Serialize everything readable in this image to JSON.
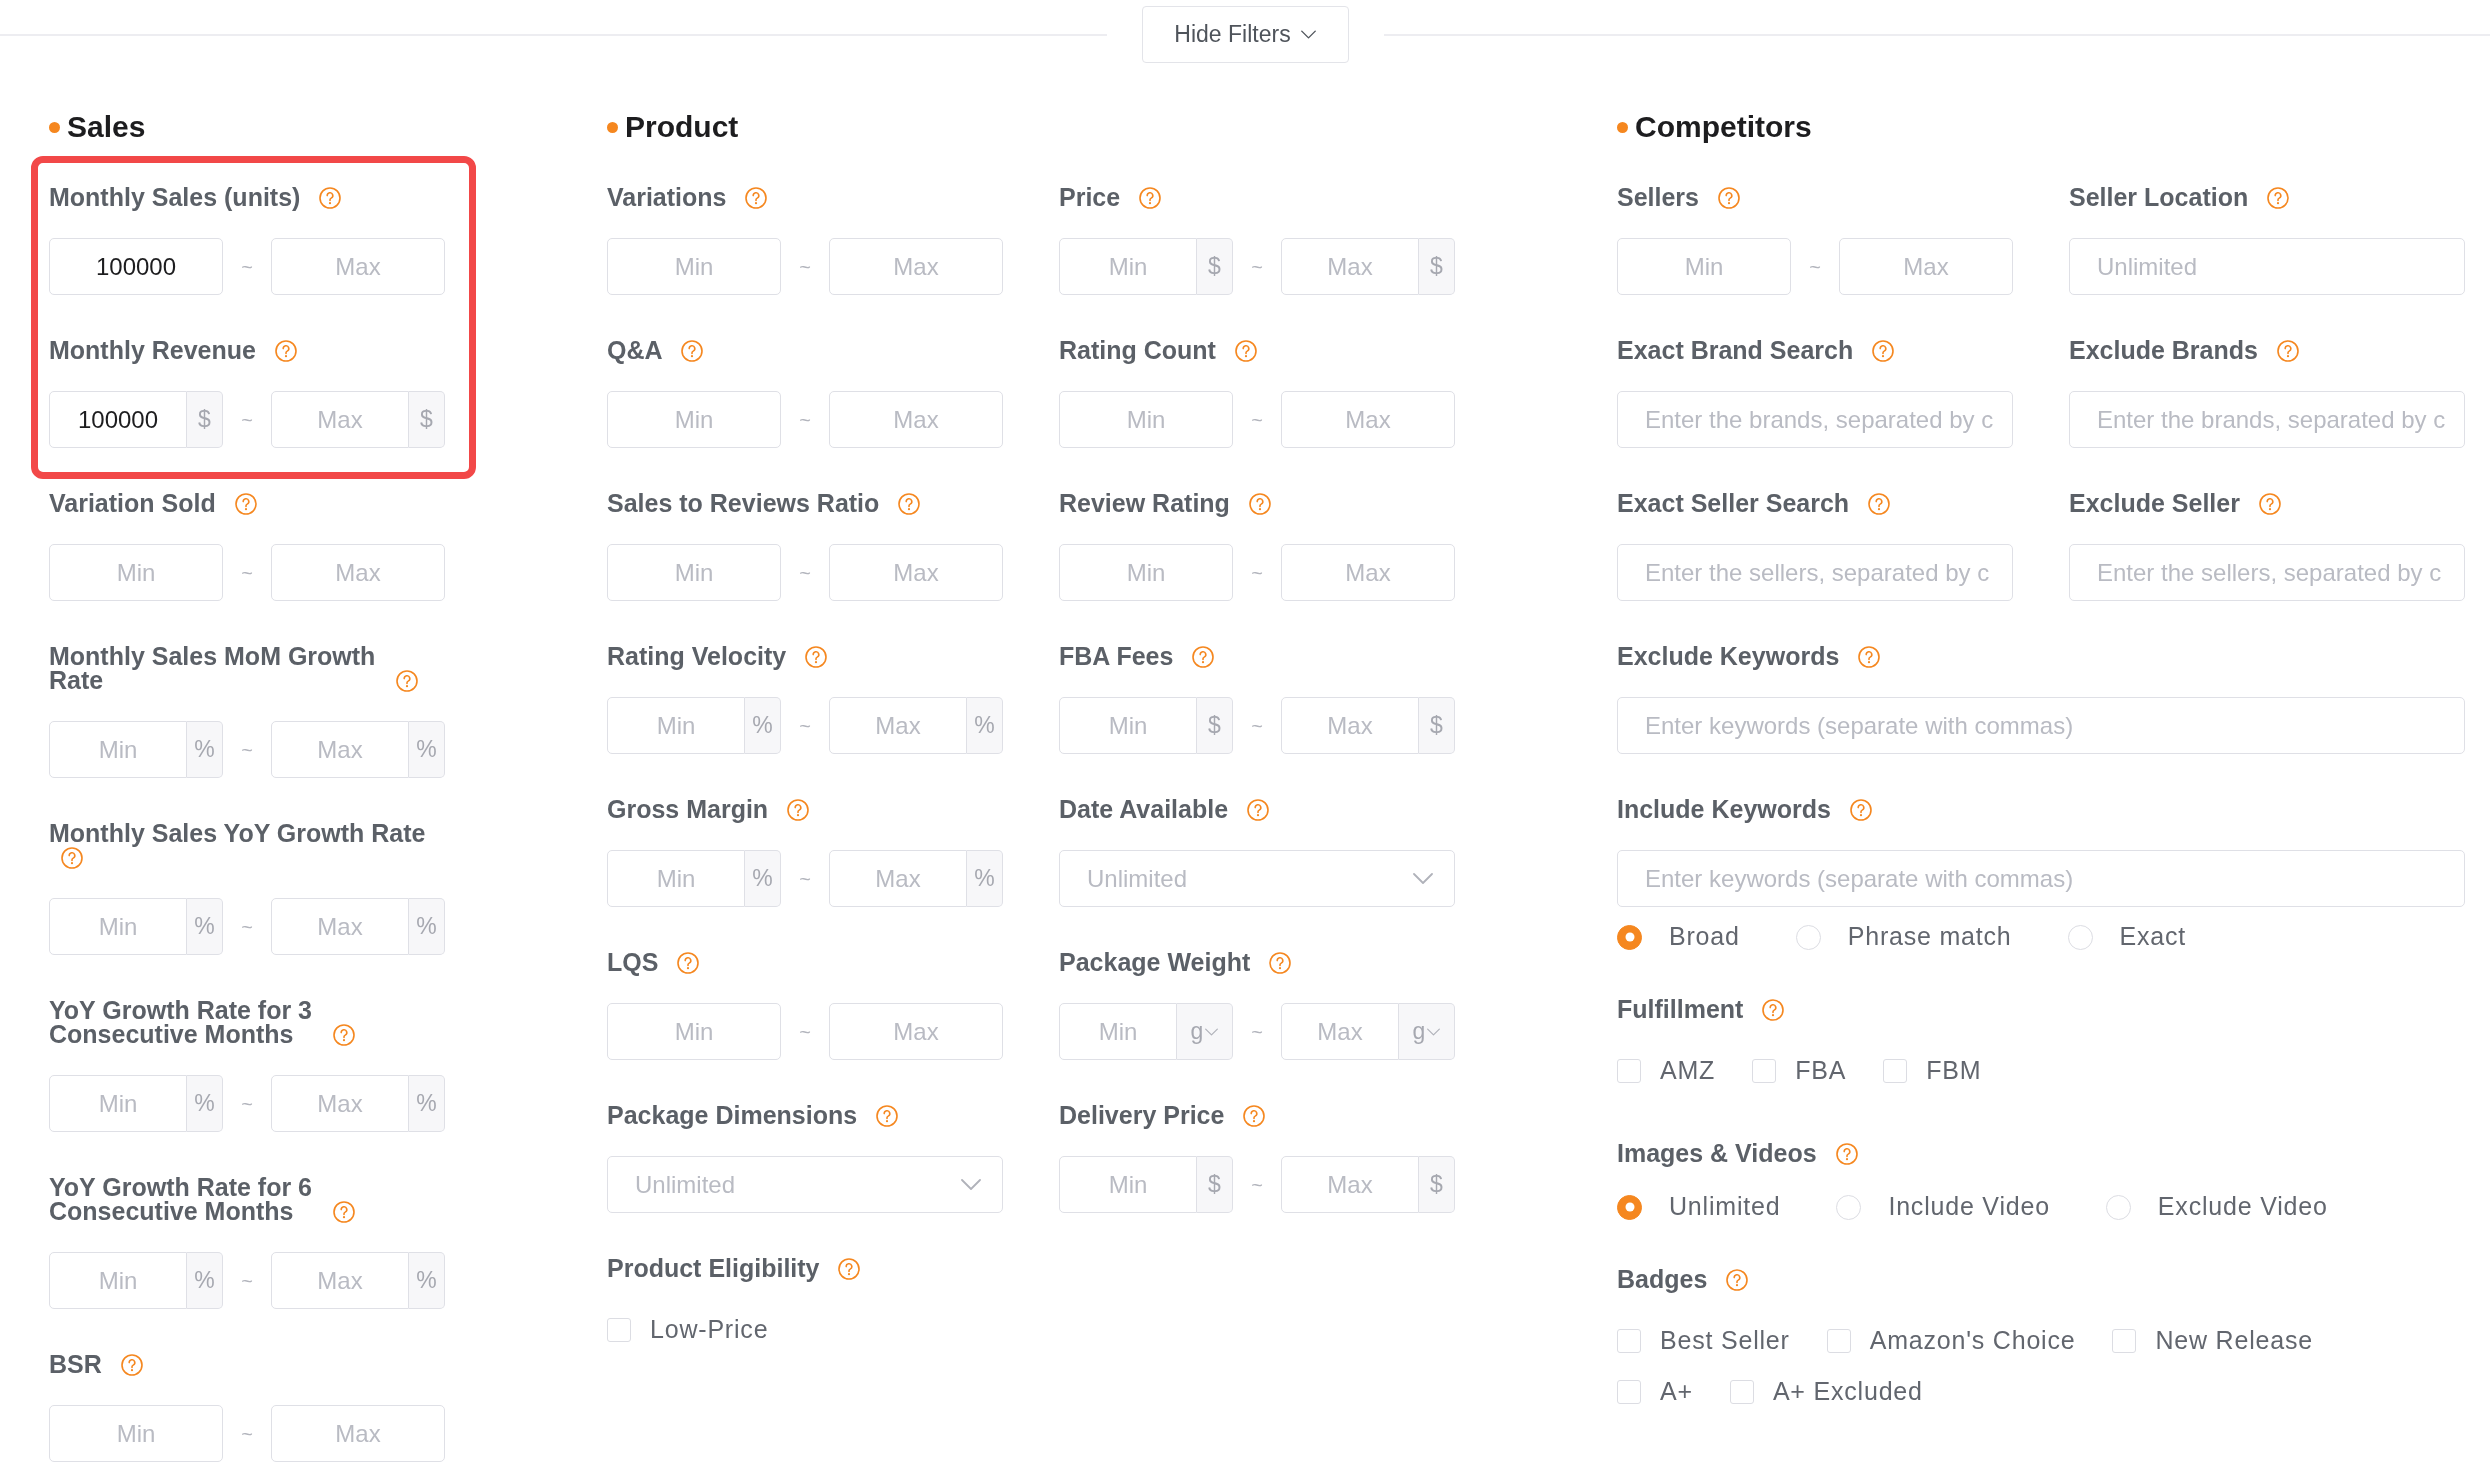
{
  "toggle_button": {
    "label": "Hide Filters"
  },
  "sections": [
    {
      "title": "Sales",
      "rows": [
        [
          {
            "label": "Monthly Sales (units)",
            "highlighted": true,
            "controls": [
              {
                "kind": "range",
                "min": {
                  "value": "100000"
                },
                "separator": "~",
                "max": {
                  "placeholder": "Max"
                }
              }
            ]
          }
        ],
        [
          {
            "label": "Monthly Revenue",
            "highlighted": true,
            "controls": [
              {
                "kind": "range",
                "min": {
                  "value": "100000",
                  "unit": {
                    "kind": "addon",
                    "text": "$"
                  }
                },
                "separator": "~",
                "max": {
                  "placeholder": "Max",
                  "unit": {
                    "kind": "addon",
                    "text": "$"
                  }
                }
              }
            ]
          }
        ],
        [
          {
            "label": "Variation Sold",
            "highlighted": false,
            "controls": [
              {
                "kind": "range",
                "min": {
                  "placeholder": "Min"
                },
                "separator": "~",
                "max": {
                  "placeholder": "Max"
                }
              }
            ]
          }
        ],
        [
          {
            "label": "Monthly Sales MoM Growth Rate",
            "highlighted": false,
            "controls": [
              {
                "kind": "range",
                "min": {
                  "placeholder": "Min",
                  "unit": {
                    "kind": "addon",
                    "text": "%"
                  }
                },
                "separator": "~",
                "max": {
                  "placeholder": "Max",
                  "unit": {
                    "kind": "addon",
                    "text": "%"
                  }
                }
              }
            ]
          }
        ],
        [
          {
            "label": "Monthly Sales YoY Growth Rate",
            "highlighted": false,
            "controls": [
              {
                "kind": "range",
                "min": {
                  "placeholder": "Min",
                  "unit": {
                    "kind": "addon",
                    "text": "%"
                  }
                },
                "separator": "~",
                "max": {
                  "placeholder": "Max",
                  "unit": {
                    "kind": "addon",
                    "text": "%"
                  }
                }
              }
            ]
          }
        ],
        [
          {
            "label": "YoY Growth Rate for 3 Consecutive Months",
            "highlighted": false,
            "controls": [
              {
                "kind": "range",
                "min": {
                  "placeholder": "Min",
                  "unit": {
                    "kind": "addon",
                    "text": "%"
                  }
                },
                "separator": "~",
                "max": {
                  "placeholder": "Max",
                  "unit": {
                    "kind": "addon",
                    "text": "%"
                  }
                }
              }
            ]
          }
        ],
        [
          {
            "label": "YoY Growth Rate for 6 Consecutive Months",
            "highlighted": false,
            "controls": [
              {
                "kind": "range",
                "min": {
                  "placeholder": "Min",
                  "unit": {
                    "kind": "addon",
                    "text": "%"
                  }
                },
                "separator": "~",
                "max": {
                  "placeholder": "Max",
                  "unit": {
                    "kind": "addon",
                    "text": "%"
                  }
                }
              }
            ]
          }
        ],
        [
          {
            "label": "BSR",
            "highlighted": false,
            "controls": [
              {
                "kind": "range",
                "min": {
                  "placeholder": "Min"
                },
                "separator": "~",
                "max": {
                  "placeholder": "Max"
                }
              }
            ]
          }
        ]
      ]
    },
    {
      "title": "Product",
      "rows": [
        [
          {
            "label": "Variations",
            "highlighted": false,
            "controls": [
              {
                "kind": "range",
                "min": {
                  "placeholder": "Min"
                },
                "separator": "~",
                "max": {
                  "placeholder": "Max"
                }
              }
            ]
          },
          {
            "label": "Price",
            "highlighted": false,
            "controls": [
              {
                "kind": "range",
                "min": {
                  "placeholder": "Min",
                  "unit": {
                    "kind": "addon",
                    "text": "$"
                  }
                },
                "separator": "~",
                "max": {
                  "placeholder": "Max",
                  "unit": {
                    "kind": "addon",
                    "text": "$"
                  }
                }
              }
            ]
          }
        ],
        [
          {
            "label": "Q&A",
            "highlighted": false,
            "controls": [
              {
                "kind": "range",
                "min": {
                  "placeholder": "Min"
                },
                "separator": "~",
                "max": {
                  "placeholder": "Max"
                }
              }
            ]
          },
          {
            "label": "Rating Count",
            "highlighted": false,
            "controls": [
              {
                "kind": "range",
                "min": {
                  "placeholder": "Min"
                },
                "separator": "~",
                "max": {
                  "placeholder": "Max"
                }
              }
            ]
          }
        ],
        [
          {
            "label": "Sales to Reviews Ratio",
            "highlighted": false,
            "controls": [
              {
                "kind": "range",
                "min": {
                  "placeholder": "Min"
                },
                "separator": "~",
                "max": {
                  "placeholder": "Max"
                }
              }
            ]
          },
          {
            "label": "Review Rating",
            "highlighted": false,
            "controls": [
              {
                "kind": "range",
                "min": {
                  "placeholder": "Min"
                },
                "separator": "~",
                "max": {
                  "placeholder": "Max"
                }
              }
            ]
          }
        ],
        [
          {
            "label": "Rating Velocity",
            "highlighted": false,
            "controls": [
              {
                "kind": "range",
                "min": {
                  "placeholder": "Min",
                  "unit": {
                    "kind": "addon",
                    "text": "%"
                  }
                },
                "separator": "~",
                "max": {
                  "placeholder": "Max",
                  "unit": {
                    "kind": "addon",
                    "text": "%"
                  }
                }
              }
            ]
          },
          {
            "label": "FBA Fees",
            "highlighted": false,
            "controls": [
              {
                "kind": "range",
                "min": {
                  "placeholder": "Min",
                  "unit": {
                    "kind": "addon",
                    "text": "$"
                  }
                },
                "separator": "~",
                "max": {
                  "placeholder": "Max",
                  "unit": {
                    "kind": "addon",
                    "text": "$"
                  }
                }
              }
            ]
          }
        ],
        [
          {
            "label": "Gross Margin",
            "highlighted": false,
            "controls": [
              {
                "kind": "range",
                "min": {
                  "placeholder": "Min",
                  "unit": {
                    "kind": "addon",
                    "text": "%"
                  }
                },
                "separator": "~",
                "max": {
                  "placeholder": "Max",
                  "unit": {
                    "kind": "addon",
                    "text": "%"
                  }
                }
              }
            ]
          },
          {
            "label": "Date Available",
            "highlighted": false,
            "controls": [
              {
                "kind": "select",
                "placeholder": "Unlimited"
              }
            ]
          }
        ],
        [
          {
            "label": "LQS",
            "highlighted": false,
            "controls": [
              {
                "kind": "range",
                "min": {
                  "placeholder": "Min"
                },
                "separator": "~",
                "max": {
                  "placeholder": "Max"
                }
              }
            ]
          },
          {
            "label": "Package Weight",
            "highlighted": false,
            "controls": [
              {
                "kind": "range",
                "min": {
                  "placeholder": "Min",
                  "unit": {
                    "kind": "select",
                    "text": "g"
                  }
                },
                "separator": "~",
                "max": {
                  "placeholder": "Max",
                  "unit": {
                    "kind": "select",
                    "text": "g"
                  }
                }
              }
            ]
          }
        ],
        [
          {
            "label": "Package Dimensions",
            "highlighted": false,
            "controls": [
              {
                "kind": "select",
                "placeholder": "Unlimited"
              }
            ]
          },
          {
            "label": "Delivery Price",
            "highlighted": false,
            "controls": [
              {
                "kind": "range",
                "min": {
                  "placeholder": "Min",
                  "unit": {
                    "kind": "addon",
                    "text": "$"
                  }
                },
                "separator": "~",
                "max": {
                  "placeholder": "Max",
                  "unit": {
                    "kind": "addon",
                    "text": "$"
                  }
                }
              }
            ]
          }
        ],
        [
          {
            "label": "Product Eligibility",
            "highlighted": false,
            "controls": [
              {
                "kind": "checkboxes",
                "rows": [
                  [
                    {
                      "label": "Low-Price",
                      "checked": false
                    }
                  ]
                ]
              }
            ]
          }
        ]
      ]
    },
    {
      "title": "Competitors",
      "rows": [
        [
          {
            "label": "Sellers",
            "highlighted": false,
            "controls": [
              {
                "kind": "range",
                "min": {
                  "placeholder": "Min"
                },
                "separator": "~",
                "max": {
                  "placeholder": "Max"
                }
              }
            ]
          },
          {
            "label": "Seller Location",
            "highlighted": false,
            "controls": [
              {
                "kind": "text",
                "placeholder": "Unlimited"
              }
            ]
          }
        ],
        [
          {
            "label": "Exact Brand Search",
            "highlighted": false,
            "controls": [
              {
                "kind": "text",
                "placeholder": "Enter the brands, separated by c"
              }
            ]
          },
          {
            "label": "Exclude Brands",
            "highlighted": false,
            "controls": [
              {
                "kind": "text",
                "placeholder": "Enter the brands, separated by c"
              }
            ]
          }
        ],
        [
          {
            "label": "Exact Seller Search",
            "highlighted": false,
            "controls": [
              {
                "kind": "text",
                "placeholder": "Enter the sellers, separated by c"
              }
            ]
          },
          {
            "label": "Exclude Seller",
            "highlighted": false,
            "controls": [
              {
                "kind": "text",
                "placeholder": "Enter the sellers, separated by c"
              }
            ]
          }
        ],
        [
          {
            "label": "Exclude Keywords",
            "highlighted": false,
            "controls": [
              {
                "kind": "text",
                "placeholder": "Enter keywords (separate with commas)"
              }
            ]
          }
        ],
        [
          {
            "label": "Include Keywords",
            "highlighted": false,
            "controls": [
              {
                "kind": "text",
                "placeholder": "Enter keywords (separate with commas)"
              },
              {
                "kind": "radios",
                "options": [
                  {
                    "label": "Broad",
                    "selected": true
                  },
                  {
                    "label": "Phrase match",
                    "selected": false
                  },
                  {
                    "label": "Exact",
                    "selected": false
                  }
                ]
              }
            ]
          }
        ],
        [
          {
            "label": "Fulfillment",
            "highlighted": false,
            "controls": [
              {
                "kind": "checkboxes",
                "rows": [
                  [
                    {
                      "label": "AMZ",
                      "checked": false
                    },
                    {
                      "label": "FBA",
                      "checked": false
                    },
                    {
                      "label": "FBM",
                      "checked": false
                    }
                  ]
                ]
              }
            ]
          }
        ],
        [
          {
            "label": "Images & Videos",
            "highlighted": false,
            "controls": [
              {
                "kind": "radios",
                "options": [
                  {
                    "label": "Unlimited",
                    "selected": true
                  },
                  {
                    "label": "Include Video",
                    "selected": false
                  },
                  {
                    "label": "Exclude Video",
                    "selected": false
                  }
                ]
              }
            ]
          }
        ],
        [
          {
            "label": "Badges",
            "highlighted": false,
            "controls": [
              {
                "kind": "checkboxes",
                "rows": [
                  [
                    {
                      "label": "Best Seller",
                      "checked": false
                    },
                    {
                      "label": "Amazon's Choice",
                      "checked": false
                    },
                    {
                      "label": "New Release",
                      "checked": false
                    }
                  ],
                  [
                    {
                      "label": "A+",
                      "checked": false
                    },
                    {
                      "label": "A+ Excluded",
                      "checked": false
                    }
                  ]
                ]
              }
            ]
          }
        ]
      ]
    }
  ]
}
